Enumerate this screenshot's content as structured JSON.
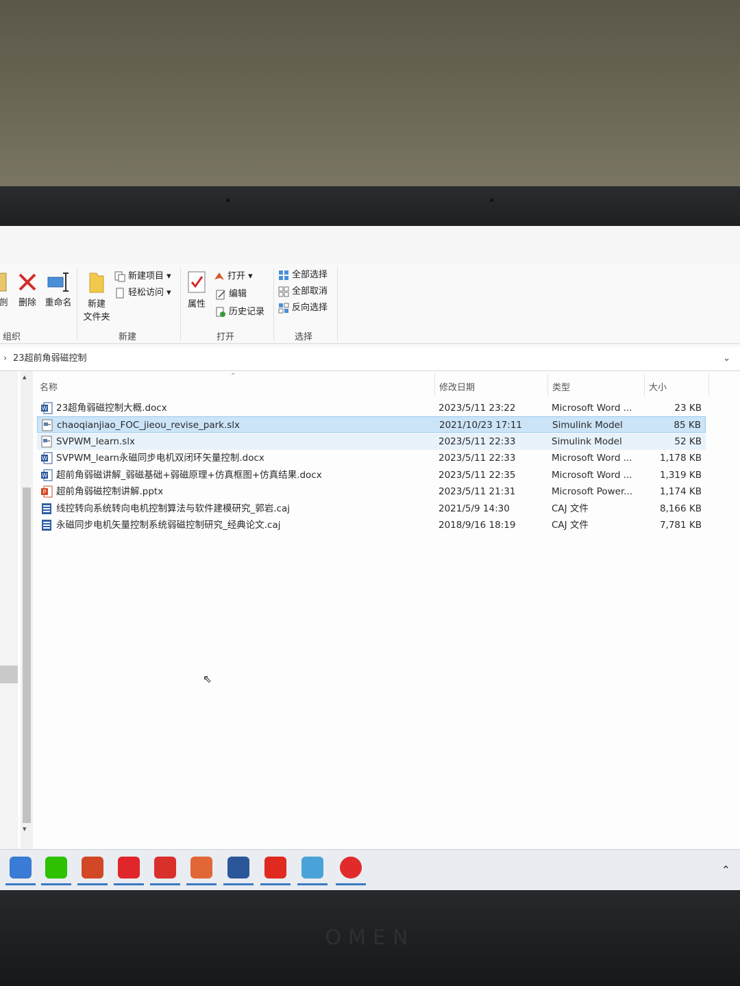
{
  "ribbon": {
    "groups": [
      {
        "label": "组织"
      },
      {
        "label": "新建"
      },
      {
        "label": "打开"
      },
      {
        "label": "选择"
      }
    ],
    "cut_label": "剪切",
    "delete_label": "删除",
    "rename_label": "重命名",
    "new_folder_label_1": "新建",
    "new_folder_label_2": "文件夹",
    "new_item_label": "新建项目 ▾",
    "easy_access_label": "轻松访问 ▾",
    "properties_label": "属性",
    "open_label": "打开 ▾",
    "edit_label": "编辑",
    "history_label": "历史记录",
    "select_all_label": "全部选择",
    "select_none_label": "全部取消",
    "invert_selection_label": "反向选择"
  },
  "address": {
    "path": "23超前角弱磁控制"
  },
  "columns": {
    "name": "名称",
    "date": "修改日期",
    "type": "类型",
    "size": "大小"
  },
  "files": [
    {
      "name": "23超角弱磁控制大概.docx",
      "date": "2023/5/11 23:22",
      "type": "Microsoft Word ...",
      "size": "23 KB",
      "icon": "word-icon"
    },
    {
      "name": "chaoqianjiao_FOC_jieou_revise_park.slx",
      "date": "2021/10/23 17:11",
      "type": "Simulink Model",
      "size": "85 KB",
      "icon": "simulink-icon"
    },
    {
      "name": "SVPWM_learn.slx",
      "date": "2023/5/11 22:33",
      "type": "Simulink Model",
      "size": "52 KB",
      "icon": "simulink-icon"
    },
    {
      "name": "SVPWM_learn永磁同步电机双闭环矢量控制.docx",
      "date": "2023/5/11 22:33",
      "type": "Microsoft Word ...",
      "size": "1,178 KB",
      "icon": "word-icon"
    },
    {
      "name": "超前角弱磁讲解_弱磁基础+弱磁原理+仿真框图+仿真结果.docx",
      "date": "2023/5/11 22:35",
      "type": "Microsoft Word ...",
      "size": "1,319 KB",
      "icon": "word-icon"
    },
    {
      "name": "超前角弱磁控制讲解.pptx",
      "date": "2023/5/11 21:31",
      "type": "Microsoft Power...",
      "size": "1,174 KB",
      "icon": "powerpoint-icon"
    },
    {
      "name": "线控转向系统转向电机控制算法与软件建模研究_郭岩.caj",
      "date": "2021/5/9 14:30",
      "type": "CAJ 文件",
      "size": "8,166 KB",
      "icon": "caj-icon"
    },
    {
      "name": "永磁同步电机矢量控制系统弱磁控制研究_经典论文.caj",
      "date": "2018/9/16 18:19",
      "type": "CAJ 文件",
      "size": "7,781 KB",
      "icon": "caj-icon"
    }
  ],
  "taskbar": {
    "apps": [
      {
        "name": "app-network-icon",
        "color": "#3a7bd5"
      },
      {
        "name": "wechat-icon",
        "color": "#2dc100"
      },
      {
        "name": "powerpoint-icon",
        "color": "#d24726"
      },
      {
        "name": "youdao-icon",
        "color": "#e0262b"
      },
      {
        "name": "car-app-icon",
        "color": "#d9302c"
      },
      {
        "name": "matlab-icon",
        "color": "#e16737"
      },
      {
        "name": "word-icon",
        "color": "#2b579a"
      },
      {
        "name": "acrobat-icon",
        "color": "#e02a20"
      },
      {
        "name": "notes-app-icon",
        "color": "#4aa3d8"
      },
      {
        "name": "music-app-icon",
        "color": "#e12b2b"
      }
    ],
    "tray_arrow": "⌃"
  },
  "laptop": {
    "brand": "OMEN"
  },
  "colors": {
    "selection": "#cce4f7",
    "accent": "#3b78c4"
  }
}
